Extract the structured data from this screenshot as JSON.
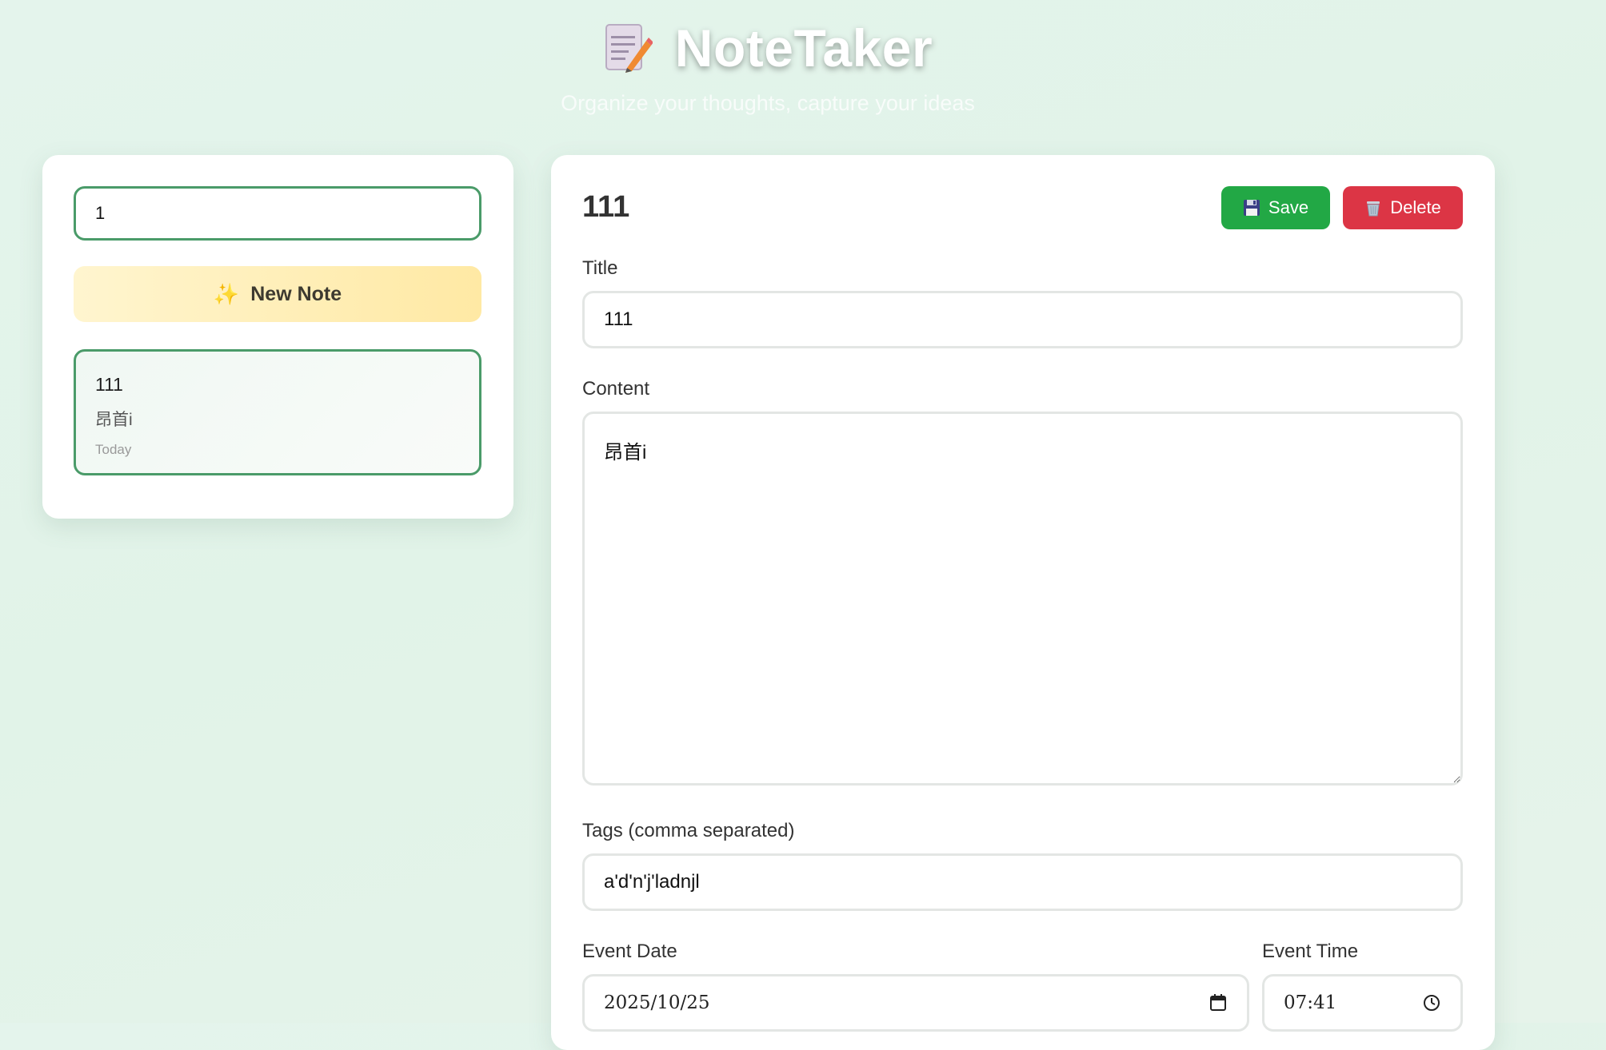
{
  "app": {
    "title": "NoteTaker",
    "tagline": "Organize your thoughts, capture your ideas",
    "logo_icon": "memo-icon"
  },
  "sidebar": {
    "search": {
      "value": "1",
      "placeholder": ""
    },
    "new_note_label": "New Note",
    "new_note_icon": "sparkles-icon",
    "notes": [
      {
        "title": "111",
        "preview": "昂首i",
        "date": "Today",
        "selected": true
      }
    ]
  },
  "editor": {
    "heading": "111",
    "save_label": "Save",
    "save_icon": "floppy-disk-icon",
    "delete_label": "Delete",
    "delete_icon": "wastebasket-icon",
    "title_label": "Title",
    "title_value": "111",
    "content_label": "Content",
    "content_value": "昂首i",
    "tags_label": "Tags (comma separated)",
    "tags_value": "a'd'n'j'ladnjl",
    "event_date_label": "Event Date",
    "event_date_value": "2025/10/25",
    "event_time_label": "Event Time",
    "event_time_value": "07:41"
  },
  "colors": {
    "accent_green": "#4a9b69",
    "save_green": "#22a845",
    "delete_red": "#dc3545",
    "new_note_yellow": "#ffe9a4"
  }
}
